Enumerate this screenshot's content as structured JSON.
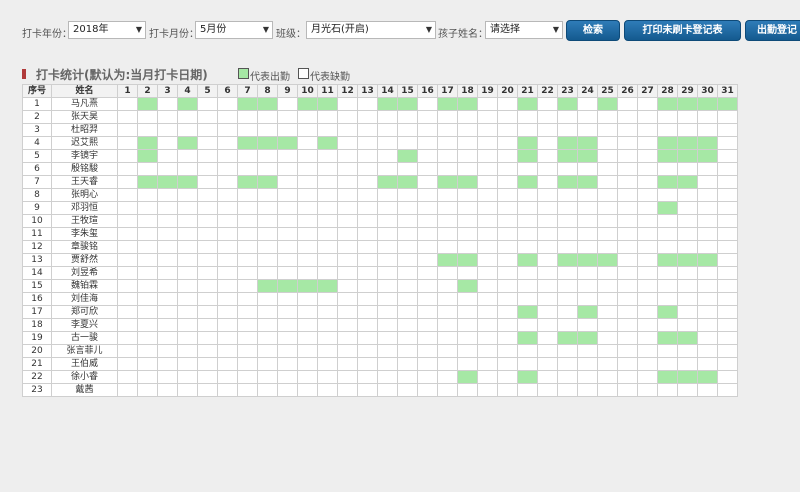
{
  "filters": {
    "year_label": "打卡年份：",
    "year_value": "2018年",
    "month_label": "打卡月份：",
    "month_value": "5月份",
    "class_label": "班级：",
    "class_value": "月光石(开启)",
    "child_label": "孩子姓名：",
    "child_value": "请选择",
    "search_button": "检索",
    "print_button": "打印未刷卡登记表",
    "export_button": "出勤登记"
  },
  "title": "打卡统计(默认为:当月打卡日期)",
  "legend": {
    "present_label": "代表出勤",
    "present_color": "#a6e8a5",
    "absent_label": "代表缺勤",
    "absent_color": "#ffffff"
  },
  "table": {
    "col_seq": "序号",
    "col_name": "姓名",
    "days": [
      "1",
      "2",
      "3",
      "4",
      "5",
      "6",
      "7",
      "8",
      "9",
      "10",
      "11",
      "12",
      "13",
      "14",
      "15",
      "16",
      "17",
      "18",
      "19",
      "20",
      "21",
      "22",
      "23",
      "24",
      "25",
      "26",
      "27",
      "28",
      "29",
      "30",
      "31"
    ],
    "rows": [
      {
        "seq": "1",
        "name": "马凡熹",
        "present": [
          2,
          4,
          7,
          8,
          10,
          11,
          14,
          15,
          17,
          18,
          21,
          23,
          25,
          28,
          29,
          30,
          31
        ]
      },
      {
        "seq": "2",
        "name": "张天昊",
        "present": []
      },
      {
        "seq": "3",
        "name": "杜昭羿",
        "present": []
      },
      {
        "seq": "4",
        "name": "迟艾熙",
        "present": [
          2,
          4,
          7,
          8,
          9,
          11,
          21,
          23,
          24,
          28,
          29,
          30
        ]
      },
      {
        "seq": "5",
        "name": "李镜宇",
        "present": [
          2,
          15,
          21,
          23,
          24,
          28,
          29,
          30
        ]
      },
      {
        "seq": "6",
        "name": "殷铭駿",
        "present": []
      },
      {
        "seq": "7",
        "name": "王天睿",
        "present": [
          2,
          3,
          4,
          7,
          8,
          14,
          15,
          17,
          18,
          21,
          23,
          24,
          28,
          29
        ]
      },
      {
        "seq": "8",
        "name": "张明心",
        "present": []
      },
      {
        "seq": "9",
        "name": "邓羽恒",
        "present": [
          28
        ]
      },
      {
        "seq": "10",
        "name": "王牧瑄",
        "present": []
      },
      {
        "seq": "11",
        "name": "李朱玺",
        "present": []
      },
      {
        "seq": "12",
        "name": "章骏铭",
        "present": []
      },
      {
        "seq": "13",
        "name": "贾舒然",
        "present": [
          17,
          18,
          21,
          23,
          24,
          25,
          28,
          29,
          30
        ]
      },
      {
        "seq": "14",
        "name": "刘昱希",
        "present": []
      },
      {
        "seq": "15",
        "name": "魏铂霖",
        "present": [
          8,
          9,
          10,
          11,
          18
        ]
      },
      {
        "seq": "16",
        "name": "刘佳海",
        "present": []
      },
      {
        "seq": "17",
        "name": "郑可欣",
        "present": [
          21,
          24,
          28
        ]
      },
      {
        "seq": "18",
        "name": "李夏兴",
        "present": []
      },
      {
        "seq": "19",
        "name": "古一骏",
        "present": [
          21,
          23,
          24,
          28,
          29
        ]
      },
      {
        "seq": "20",
        "name": "张言菲儿",
        "present": []
      },
      {
        "seq": "21",
        "name": "王伯威",
        "present": []
      },
      {
        "seq": "22",
        "name": "徐小睿",
        "present": [
          18,
          21,
          28,
          29,
          30
        ]
      },
      {
        "seq": "23",
        "name": "戴茜",
        "present": []
      }
    ]
  }
}
